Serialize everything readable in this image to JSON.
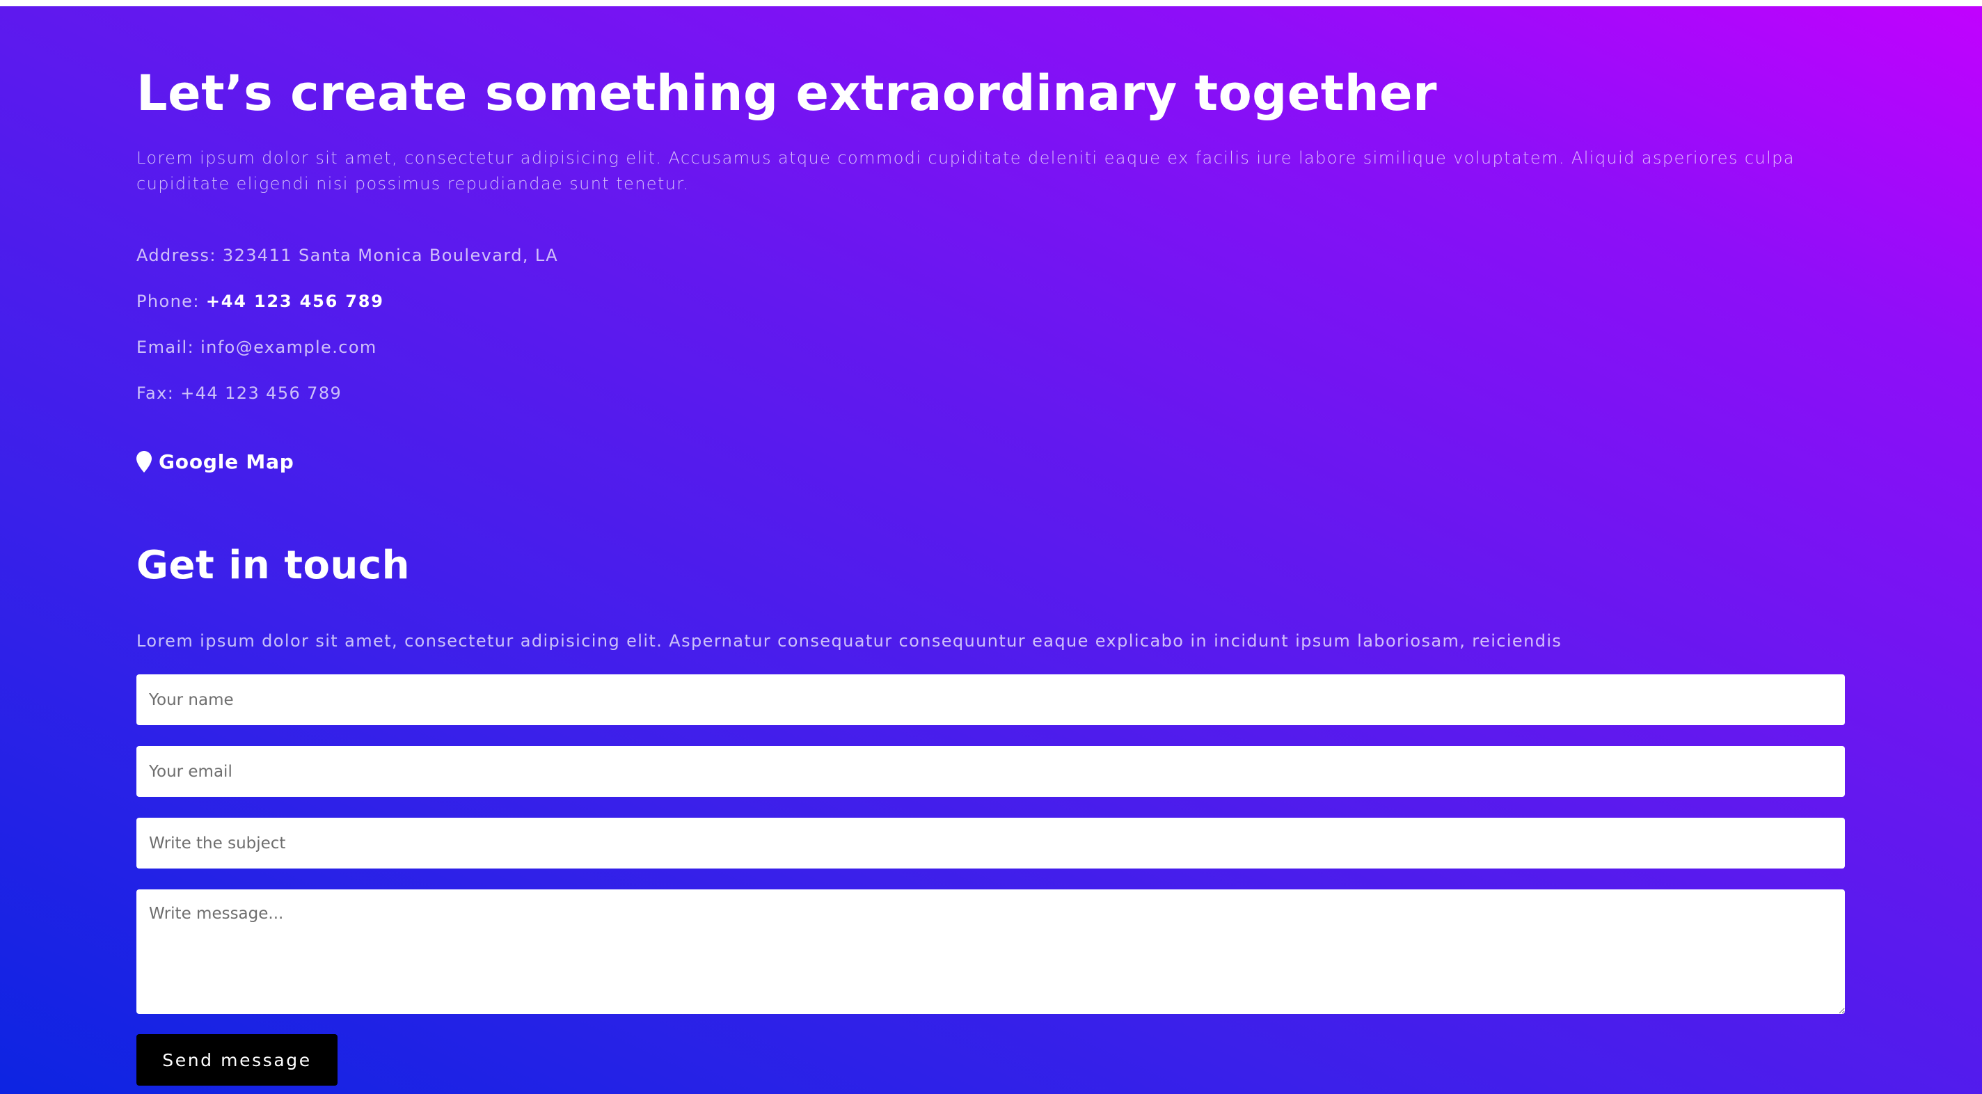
{
  "colors": {
    "gradient_start": "#0d24e2",
    "gradient_end": "#c102fe",
    "button_bg": "#000000",
    "text": "#ffffff"
  },
  "hero": {
    "title": "Let’s create something extraordinary together",
    "intro": "Lorem ipsum dolor sit amet, consectetur adipisicing elit. Accusamus atque commodi cupiditate deleniti eaque ex facilis iure labore similique voluptatem. Aliquid asperiores culpa cupiditate eligendi nisi possimus repudiandae sunt tenetur."
  },
  "contact": {
    "address_label": "Address:",
    "address_value": "323411 Santa Monica Boulevard, LA",
    "phone_label": "Phone:",
    "phone_value": "+44 123 456 789",
    "email_label": "Email:",
    "email_value": "info@example.com",
    "fax_label": "Fax:",
    "fax_value": "+44 123 456 789",
    "map_link_label": "Google Map",
    "map_icon": "map-pin-icon"
  },
  "form": {
    "title": "Get in touch",
    "description": "Lorem ipsum dolor sit amet, consectetur adipisicing elit. Aspernatur consequatur consequuntur eaque explicabo in incidunt ipsum laboriosam, reiciendis",
    "name_placeholder": "Your name",
    "email_placeholder": "Your email",
    "subject_placeholder": "Write the subject",
    "message_placeholder": "Write message...",
    "submit_label": "Send message"
  }
}
